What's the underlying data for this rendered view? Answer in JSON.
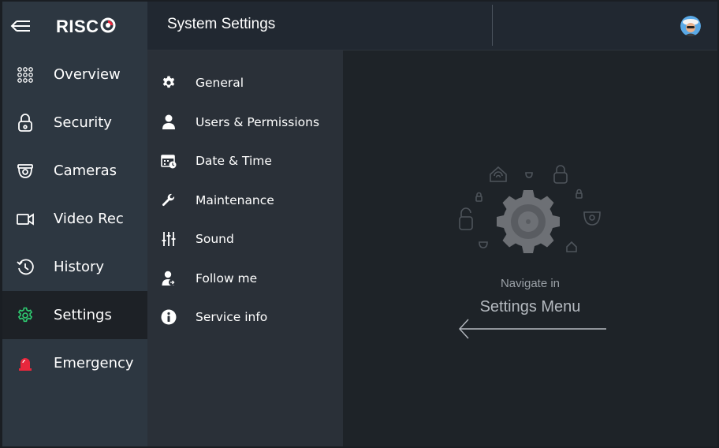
{
  "header": {
    "logo_text": "RISC",
    "title": "System Settings"
  },
  "sidebar": {
    "items": [
      {
        "label": "Overview",
        "icon": "grid-dots-icon"
      },
      {
        "label": "Security",
        "icon": "lock-icon"
      },
      {
        "label": "Cameras",
        "icon": "camera-icon"
      },
      {
        "label": "Video Rec",
        "icon": "video-rec-icon"
      },
      {
        "label": "History",
        "icon": "history-icon"
      },
      {
        "label": "Settings",
        "icon": "gear-icon",
        "active": true
      },
      {
        "label": "Emergency",
        "icon": "siren-icon"
      }
    ]
  },
  "submenu": {
    "items": [
      {
        "label": "General",
        "icon": "gear-icon"
      },
      {
        "label": "Users & Permissions",
        "icon": "user-icon"
      },
      {
        "label": "Date & Time",
        "icon": "calendar-clock-icon"
      },
      {
        "label": "Maintenance",
        "icon": "wrench-icon"
      },
      {
        "label": "Sound",
        "icon": "sliders-icon"
      },
      {
        "label": "Follow me",
        "icon": "follow-me-icon"
      },
      {
        "label": "Service info",
        "icon": "info-icon"
      }
    ]
  },
  "content": {
    "hint_small": "Navigate in",
    "hint_big": "Settings Menu"
  },
  "colors": {
    "accent_green": "#2ecc71",
    "emergency_red": "#e8273c",
    "sidebar_bg": "#2d3741",
    "active_bg": "#1d2126"
  }
}
